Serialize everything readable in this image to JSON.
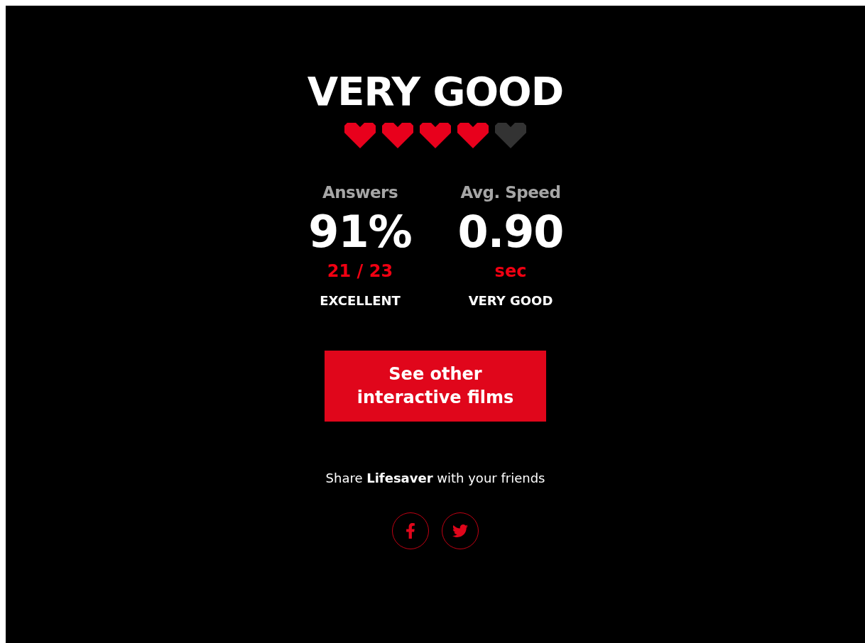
{
  "result": {
    "title": "VERY GOOD",
    "stars": 4
  },
  "stats": [
    {
      "label": "Answers",
      "value": "91%",
      "detail": "21 / 23",
      "verdict": "EXCELLENT"
    },
    {
      "label": "Avg. Speed",
      "value": "0.90",
      "detail": "sec",
      "verdict": "VERY GOOD"
    }
  ],
  "cta": {
    "label": "See other interactive films"
  },
  "share": {
    "text": "Share **Lifesaver** with your friends",
    "networks": [
      {
        "kind": "facebook"
      },
      {
        "kind": "twitter"
      }
    ]
  }
}
